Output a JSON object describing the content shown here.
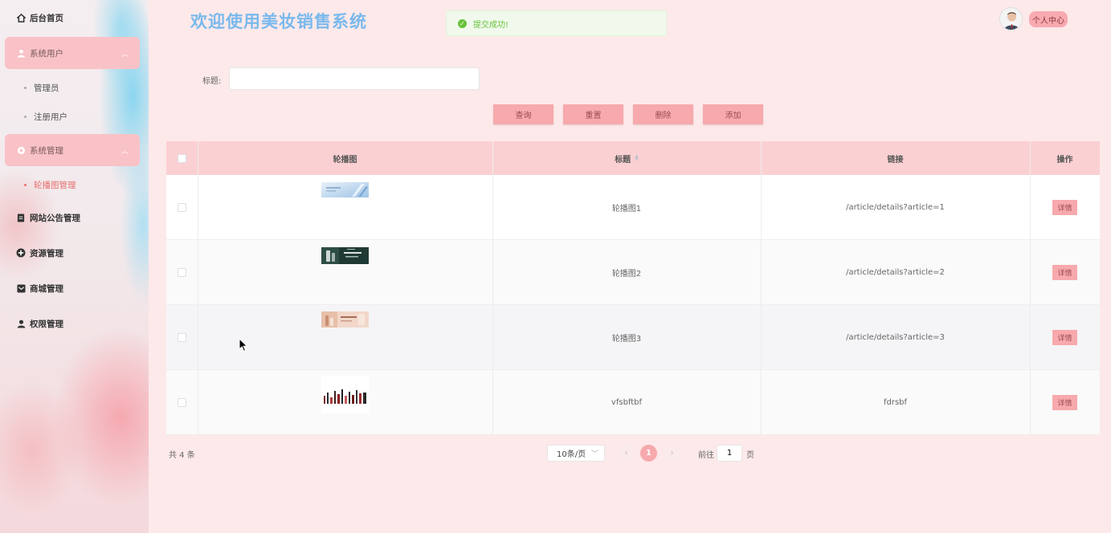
{
  "header": {
    "title": "欢迎使用美妆销售系统",
    "toast": "提交成功!",
    "profile_label": "个人中心"
  },
  "sidebar": {
    "home": "后台首页",
    "groups": [
      {
        "label": "系统用户",
        "icon": "user-icon",
        "children": [
          "管理员",
          "注册用户"
        ]
      },
      {
        "label": "系统管理",
        "icon": "gear-icon",
        "children": [
          "轮播图管理"
        ]
      }
    ],
    "items": [
      {
        "label": "网站公告管理",
        "icon": "document-icon"
      },
      {
        "label": "资源管理",
        "icon": "plus-circle-icon"
      },
      {
        "label": "商城管理",
        "icon": "mail-icon"
      },
      {
        "label": "权限管理",
        "icon": "user-icon"
      }
    ],
    "active": "轮播图管理"
  },
  "search": {
    "label": "标题:",
    "value": "",
    "placeholder": ""
  },
  "toolbar": {
    "query": "查询",
    "reset": "重置",
    "delete": "删除",
    "add": "添加"
  },
  "table": {
    "columns": [
      "轮播图",
      "标题",
      "链接",
      "操作"
    ],
    "sortable_column": "标题",
    "rows": [
      {
        "title": "轮播图1",
        "link": "/article/details?article=1",
        "action": "详情"
      },
      {
        "title": "轮播图2",
        "link": "/article/details?article=2",
        "action": "详情"
      },
      {
        "title": "轮播图3",
        "link": "/article/details?article=3",
        "action": "详情"
      },
      {
        "title": "vfsbftbf",
        "link": "fdrsbf",
        "action": "详情"
      }
    ]
  },
  "pagination": {
    "total": "共 4 条",
    "page_size": "10条/页",
    "current_page": "1",
    "goto_prefix": "前往",
    "goto_value": "1",
    "goto_suffix": "页"
  },
  "colors": {
    "accent": "#f7a9ad",
    "header_row": "#fbd0d3",
    "title": "#7ab9ec",
    "success": "#67c23a"
  }
}
